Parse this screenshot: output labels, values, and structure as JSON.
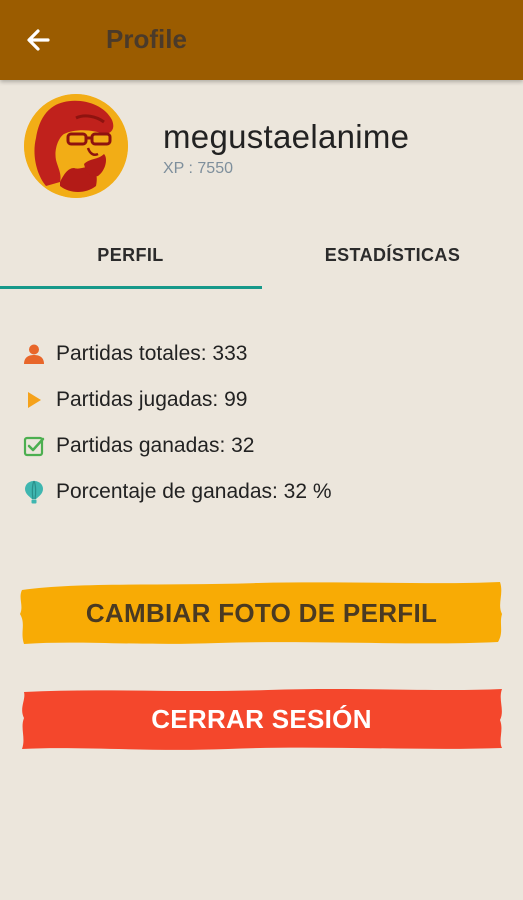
{
  "appbar": {
    "title": "Profile",
    "back_icon": "arrow-left-icon",
    "bg_color": "#9b5c00"
  },
  "profile": {
    "username": "megustaelanime",
    "xp_text": "XP : 7550",
    "avatar_icon": "user-avatar"
  },
  "tabs": [
    {
      "label": "PERFIL",
      "selected": true
    },
    {
      "label": "ESTADÍSTICAS",
      "selected": false
    }
  ],
  "tab_indicator_color": "#16998a",
  "stats": [
    {
      "icon": "person-icon",
      "color": "#e8662a",
      "text": "Partidas totales: 333"
    },
    {
      "icon": "play-icon",
      "color": "#f5a21b",
      "text": "Partidas jugadas: 99"
    },
    {
      "icon": "checkbox-icon",
      "color": "#4caf50",
      "text": "Partidas ganadas: 32"
    },
    {
      "icon": "balloon-icon",
      "color": "#3fb6b0",
      "text": "Porcentaje de ganadas: 32 %"
    }
  ],
  "buttons": {
    "change_photo": {
      "label": "CAMBIAR FOTO DE PERFIL",
      "color": "#f8ab05"
    },
    "logout": {
      "label": "CERRAR SESIÓN",
      "color": "#f4472c"
    }
  }
}
